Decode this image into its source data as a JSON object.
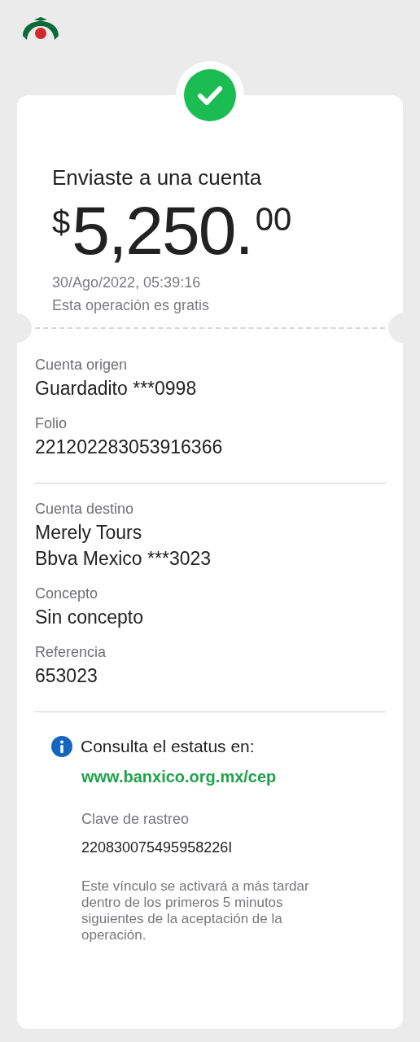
{
  "header": {
    "title": "Enviaste a una cuenta",
    "amount": {
      "currency": "$",
      "integer": "5,250.",
      "decimals": "00"
    },
    "datetime": "30/Ago/2022, 05:39:16",
    "fee_note": "Esta operación es gratis"
  },
  "sections": [
    {
      "fields": [
        {
          "label": "Cuenta origen",
          "lines": [
            "Guardadito ***0998"
          ]
        },
        {
          "label": "Folio",
          "lines": [
            "221202283053916366"
          ]
        }
      ]
    },
    {
      "fields": [
        {
          "label": "Cuenta destino",
          "lines": [
            "Merely Tours",
            "Bbva Mexico ***3023"
          ]
        },
        {
          "label": "Concepto",
          "lines": [
            "Sin concepto"
          ]
        },
        {
          "label": "Referencia",
          "lines": [
            "653023"
          ]
        }
      ]
    }
  ],
  "info": {
    "heading": "Consulta el estatus en:",
    "link": "www.banxico.org.mx/cep",
    "tracking_label": "Clave de rastreo",
    "tracking_value": "220830075495958226I",
    "note": "Este vínculo se activará a más tardar dentro de los primeros 5 minutos siguientes de la aceptación de la operación."
  }
}
